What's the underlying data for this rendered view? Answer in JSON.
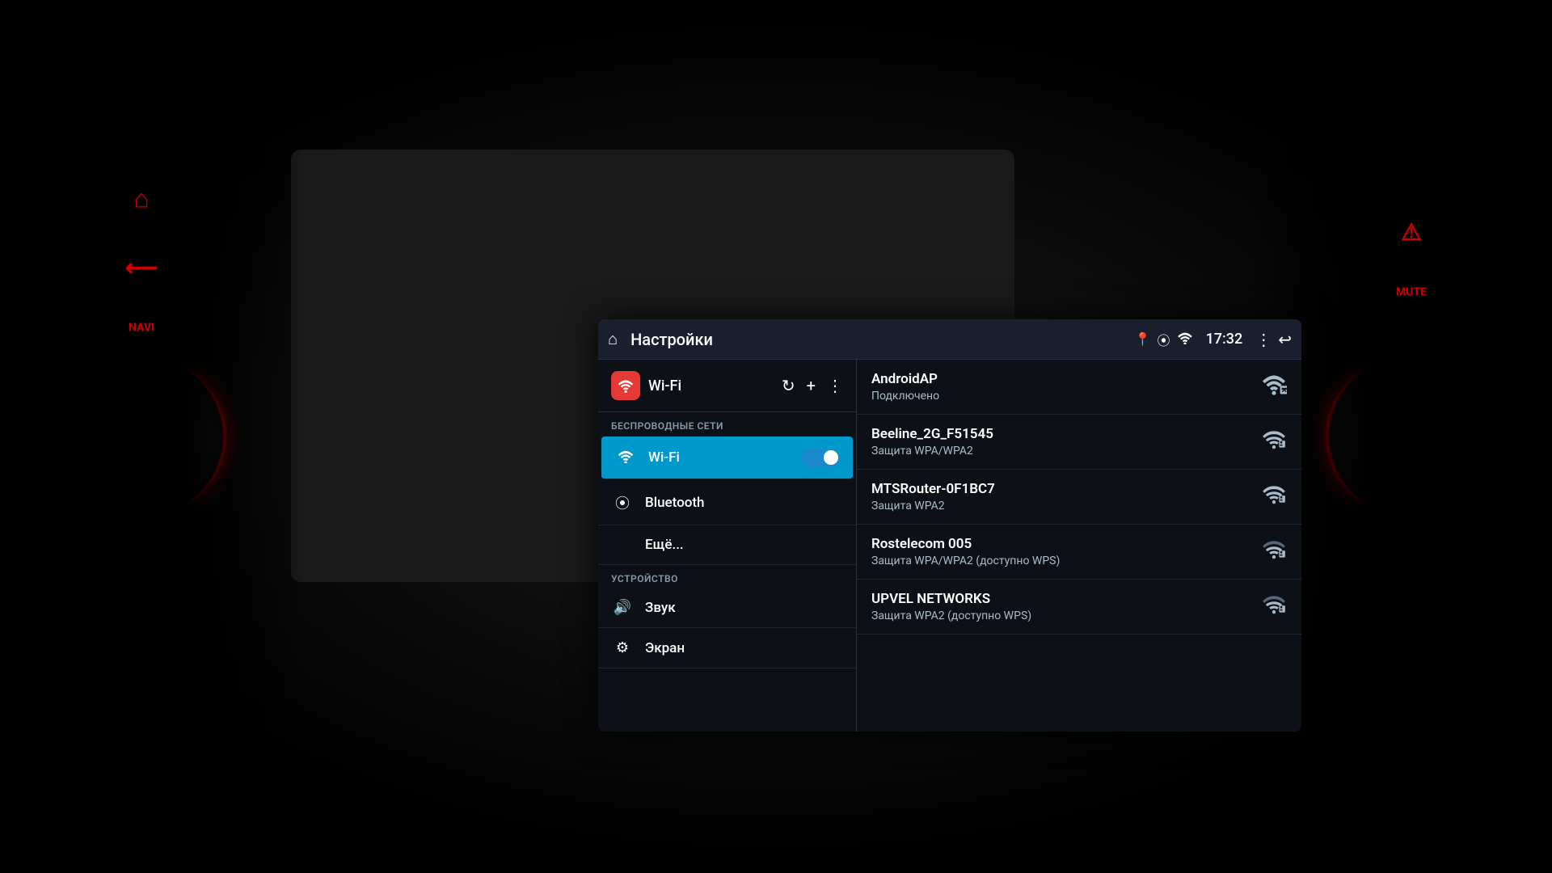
{
  "dashboard": {
    "background_color": "#000000"
  },
  "top_bar": {
    "title": "Настройки",
    "time": "17:32",
    "home_icon": "⌂",
    "back_icon": "↩"
  },
  "sidebar": {
    "wifi_section_header": "БЕСПРОВОДНЫЕ СЕТИ",
    "device_section_header": "УСТРОЙСТВО",
    "items": [
      {
        "id": "wifi",
        "label": "Wi-Fi",
        "icon": "📶",
        "active": true
      },
      {
        "id": "bluetooth",
        "label": "Bluetooth",
        "icon": "◉",
        "active": false
      },
      {
        "id": "more",
        "label": "Ещё...",
        "icon": "",
        "active": false
      },
      {
        "id": "sound",
        "label": "Звук",
        "icon": "🔊",
        "active": false
      },
      {
        "id": "screen",
        "label": "Экран",
        "icon": "⚙",
        "active": false
      }
    ]
  },
  "networks": [
    {
      "name": "AndroidAP",
      "status": "Подключено",
      "signal": "high",
      "locked": false
    },
    {
      "name": "Beeline_2G_F51545",
      "status": "Защита WPA/WPA2",
      "signal": "medium",
      "locked": true
    },
    {
      "name": "MTSRouter-0F1BC7",
      "status": "Защита WPA2",
      "signal": "medium",
      "locked": true
    },
    {
      "name": "Rostelecom 005",
      "status": "Защита WPA/WPA2 (доступно WPS)",
      "signal": "low",
      "locked": true
    },
    {
      "name": "UPVEL NETWORKS",
      "status": "Защита WPA2 (доступно WPS)",
      "signal": "low",
      "locked": true
    }
  ],
  "wifi_header": {
    "label": "Wi-Fi"
  }
}
